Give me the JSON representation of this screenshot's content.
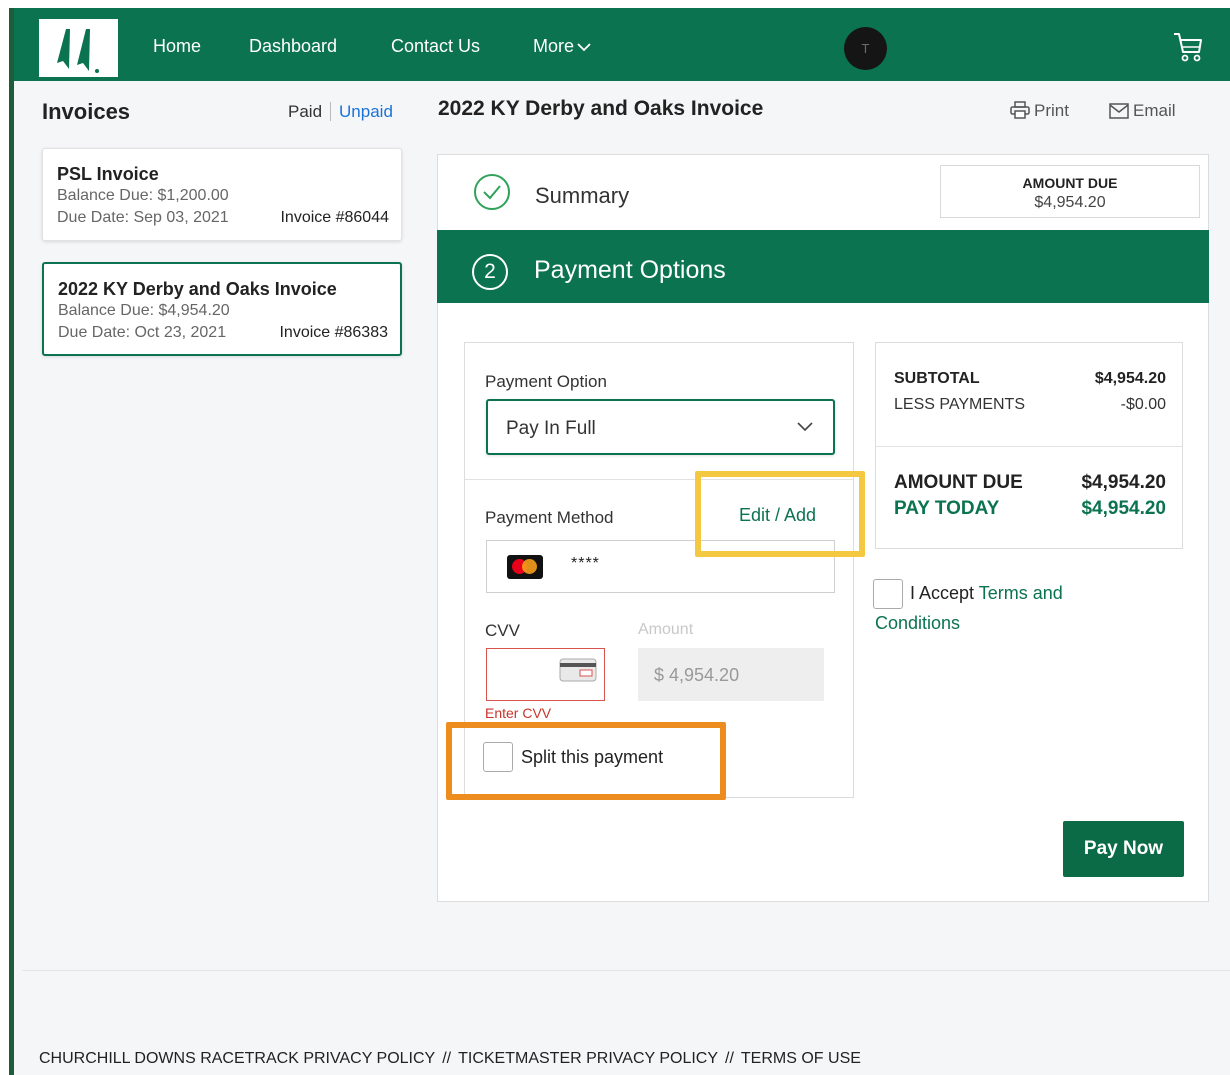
{
  "nav": {
    "home": "Home",
    "dashboard": "Dashboard",
    "contact": "Contact Us",
    "more": "More",
    "avatar_initial": "T"
  },
  "sidebar": {
    "title": "Invoices",
    "filter_paid": "Paid",
    "filter_unpaid": "Unpaid",
    "invoices": [
      {
        "name": "PSL Invoice",
        "balance": "Balance Due: $1,200.00",
        "due_date": "Due Date: Sep 03, 2021",
        "number": "Invoice #86044"
      },
      {
        "name": "2022 KY Derby and Oaks Invoice",
        "balance": "Balance Due: $4,954.20",
        "due_date": "Due Date: Oct 23, 2021",
        "number": "Invoice #86383"
      }
    ]
  },
  "main": {
    "title": "2022 KY Derby and Oaks Invoice",
    "print": "Print",
    "email": "Email",
    "summary_label": "Summary",
    "amount_due_label": "AMOUNT DUE",
    "amount_due_value": "$4,954.20",
    "step_number": "2",
    "payment_options_title": "Payment Options",
    "payment_option_label": "Payment Option",
    "payment_option_value": "Pay In Full",
    "payment_method_label": "Payment Method",
    "edit_add": "Edit / Add",
    "card_mask": "****",
    "cvv_label": "CVV",
    "amount_label": "Amount",
    "amount_value": "$ 4,954.20",
    "cvv_error": "Enter CVV",
    "split_label": "Split this payment",
    "totals": {
      "subtotal_label": "SUBTOTAL",
      "subtotal_value": "$4,954.20",
      "less_label": "LESS PAYMENTS",
      "less_value": "-$0.00",
      "due_label": "AMOUNT DUE",
      "due_value": "$4,954.20",
      "today_label": "PAY TODAY",
      "today_value": "$4,954.20"
    },
    "accept_prefix": "I Accept",
    "terms_part1": "Terms and",
    "terms_part2": "Conditions",
    "pay_now": "Pay Now"
  },
  "footer": {
    "links": [
      "CHURCHILL DOWNS RACETRACK PRIVACY POLICY",
      "TICKETMASTER PRIVACY POLICY",
      "TERMS OF USE"
    ],
    "separator": "//"
  },
  "colors": {
    "brand_green": "#0b7350",
    "link_blue": "#1a73d9",
    "error_red": "#c8342a",
    "highlight_yellow": "#f5c842",
    "highlight_orange": "#ed8c1f"
  },
  "icons": [
    "twin-spires-logo-icon",
    "chevron-down-icon",
    "cart-icon",
    "printer-icon",
    "envelope-icon",
    "check-circle-icon",
    "mastercard-icon",
    "credit-card-icon"
  ]
}
